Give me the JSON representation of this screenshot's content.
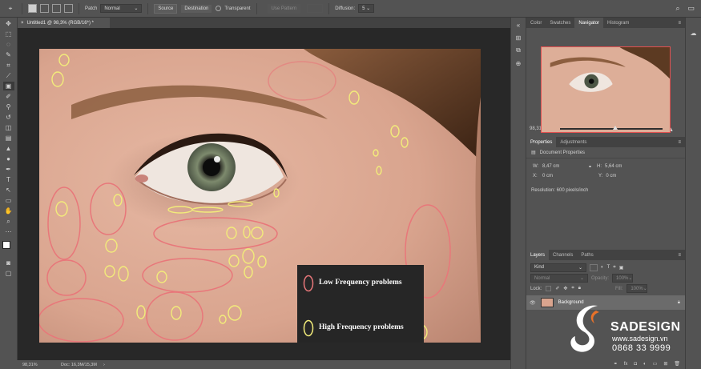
{
  "options_bar": {
    "mode_label": "Patch",
    "mode_value": "Normal",
    "source_label": "Source",
    "destination_label": "Destination",
    "transparent_label": "Transparent",
    "use_pattern_label": "Use Pattern",
    "diffusion_label": "Diffusion:",
    "diffusion_value": "5"
  },
  "document_tab": {
    "title": "Untitled1 @ 98,3% (RGB/16*) *"
  },
  "legend": {
    "low_label": "Low Frequency problems",
    "high_label": "High Frequency problems",
    "low_color": "#e8777a",
    "high_color": "#f2ec7a"
  },
  "status_bar": {
    "zoom": "98,31%",
    "doc_info": "Doc: 16,3M/15,3M"
  },
  "navigator_panel": {
    "tabs": [
      "Color",
      "Swatches",
      "Navigator",
      "Histogram"
    ],
    "active_tab": "Navigator",
    "zoom": "98,31%"
  },
  "properties_panel": {
    "tabs": [
      "Properties",
      "Adjustments"
    ],
    "active_tab": "Properties",
    "heading": "Document Properties",
    "w_label": "W:",
    "w_value": "8,47 cm",
    "h_label": "H:",
    "h_value": "5,64 cm",
    "x_label": "X:",
    "x_value": "0 cm",
    "y_label": "Y:",
    "y_value": "0 cm",
    "resolution": "Resolution: 600 pixels/inch"
  },
  "layers_panel": {
    "tabs": [
      "Layers",
      "Channels",
      "Paths"
    ],
    "active_tab": "Layers",
    "filter_value": "Kind",
    "blend_mode": "Normal",
    "opacity_label": "Opacity:",
    "opacity_value": "100%",
    "lock_label": "Lock:",
    "fill_label": "Fill:",
    "fill_value": "100%",
    "layer_name": "Background"
  },
  "watermark": {
    "brand": "SADESIGN",
    "website": "www.sadesign.vn",
    "phone": "0868 33 9999"
  }
}
